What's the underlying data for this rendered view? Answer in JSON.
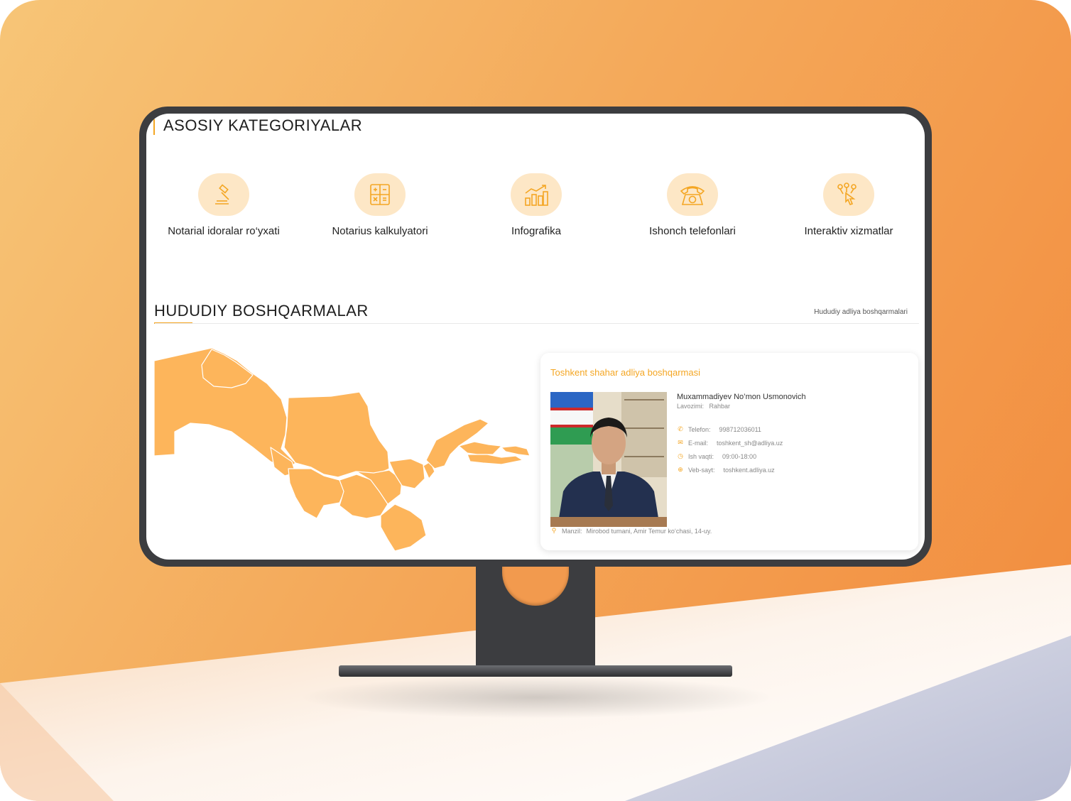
{
  "categories_section": {
    "title": "ASOSIY KATEGORIYALAR",
    "items": [
      {
        "label": "Notarial idoralar ro‘yxati",
        "icon": "gavel-icon"
      },
      {
        "label": "Notarius kalkulyatori",
        "icon": "calculator-icon"
      },
      {
        "label": "Infografika",
        "icon": "chart-icon"
      },
      {
        "label": "Ishonch telefonlari",
        "icon": "phone-icon"
      },
      {
        "label": "Interaktiv xizmatlar",
        "icon": "touch-icon"
      }
    ]
  },
  "regions_section": {
    "title": "HUDUDIY BOSHQARMALAR",
    "link": "Hududiy adliya boshqarmalari"
  },
  "office_card": {
    "title": "Toshkent shahar adliya boshqarmasi",
    "person_name": "Muxammadiyev No’mon Usmonovich",
    "position_label": "Lavozimi:",
    "position_value": "Rahbar",
    "phone_label": "Telefon:",
    "phone_value": "998712036011",
    "email_label": "E-mail:",
    "email_value": "toshkent_sh@adliya.uz",
    "hours_label": "Ish vaqti:",
    "hours_value": "09:00-18:00",
    "website_label": "Veb-sayt:",
    "website_value": "toshkent.adliya.uz",
    "address_label": "Manzil:",
    "address_value": "Mirobod tumani, Amir Temur ko‘chasi, 14-uy."
  },
  "colors": {
    "accent": "#f4a623",
    "map_fill": "#fdb55b",
    "icon_bg": "#fde7c6",
    "monitor": "#3c3d40"
  }
}
